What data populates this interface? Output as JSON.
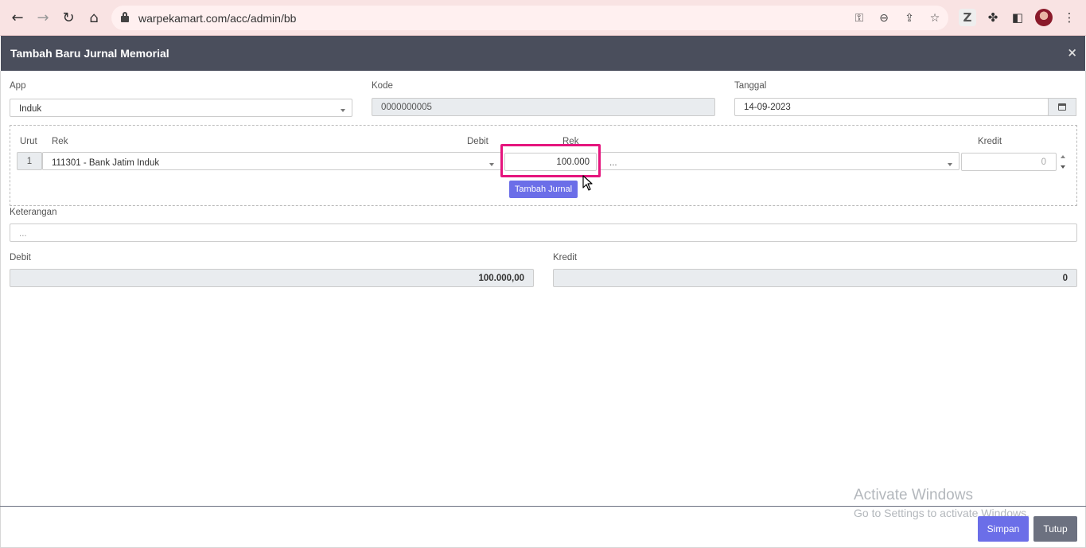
{
  "browser": {
    "url": "warpekamart.com/acc/admin/bb"
  },
  "modal": {
    "title": "Tambah Baru Jurnal Memorial",
    "close_glyph": "×"
  },
  "form": {
    "app_label": "App",
    "app_value": "Induk",
    "kode_label": "Kode",
    "kode_value": "0000000005",
    "tanggal_label": "Tanggal",
    "tanggal_value": "14-09-2023"
  },
  "journal": {
    "col_urut": "Urut",
    "col_rek_debit": "Rek",
    "col_debit": "Debit",
    "col_rek_kredit": "Rek",
    "col_kredit": "Kredit",
    "row": {
      "urut": "1",
      "rek_debit": "111301 - Bank Jatim Induk",
      "debit": "100.000",
      "rek_kredit": "...",
      "kredit": "0"
    },
    "add_button": "Tambah Jurnal"
  },
  "keterangan": {
    "label": "Keterangan",
    "placeholder": "..."
  },
  "totals": {
    "debit_label": "Debit",
    "debit_value": "100.000,00",
    "kredit_label": "Kredit",
    "kredit_value": "0"
  },
  "footer": {
    "save_label": "Simpan",
    "close_label": "Tutup"
  },
  "watermark": {
    "line1": "Activate Windows",
    "line2": "Go to Settings to activate Windows."
  },
  "colors": {
    "primary": "#6b6ee8",
    "header": "#4a4e5c",
    "highlight": "#e5157d"
  }
}
